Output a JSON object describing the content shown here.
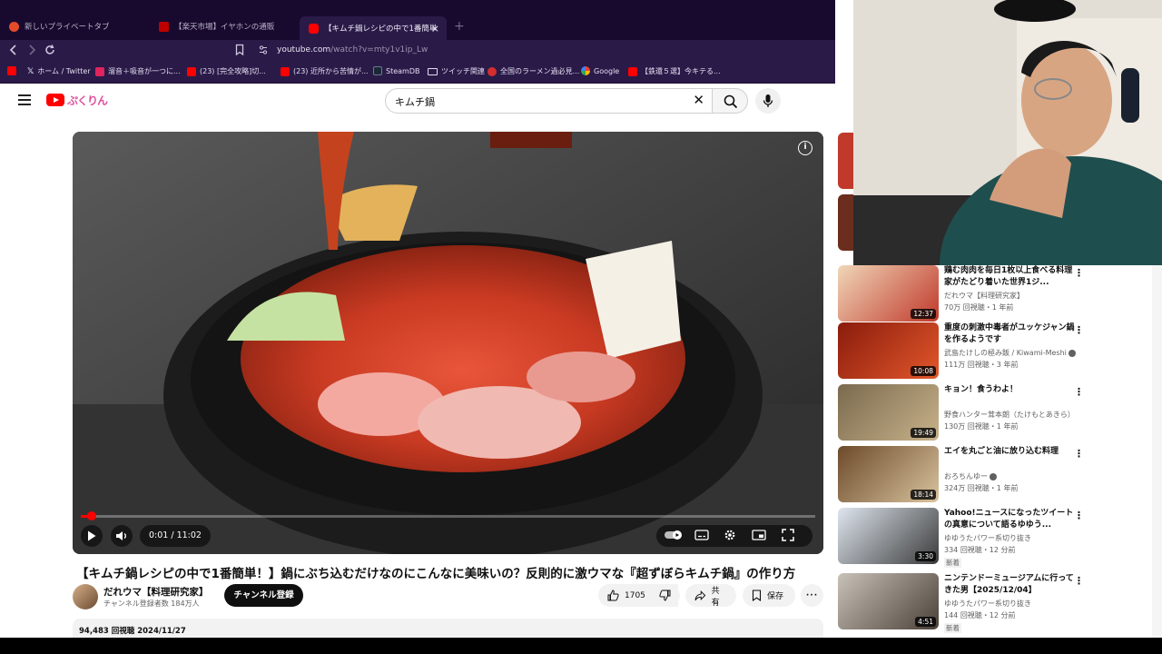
{
  "browser": {
    "tabs": [
      {
        "label": "新しいプライベートタブ",
        "color": "#e34b2a",
        "active": false
      },
      {
        "label": "【楽天市場】イヤホンの通販",
        "color": "#bf0000",
        "active": false
      },
      {
        "label": "【キムチ鍋レシピの中で1番簡単！】鍋",
        "color": "#ff0000",
        "active": true
      }
    ],
    "close_glyph": "×",
    "new_tab_glyph": "+",
    "url_host": "youtube.com",
    "url_path": "/watch?v=mty1v1ip_Lw",
    "bookmarks": [
      {
        "label": "",
        "color": "#ff0000"
      },
      {
        "label": "ホーム / Twitter",
        "color": "#000000"
      },
      {
        "label": "溜音＋吸音が一つに...",
        "color": "#e0245e"
      },
      {
        "label": "(23) [完全攻略]切...",
        "color": "#ff0000"
      },
      {
        "label": "(23) 近所から苦情が...",
        "color": "#ff0000"
      },
      {
        "label": "SteamDB",
        "color": "#1b2838"
      },
      {
        "label": "ツイッチ関連",
        "color": "#f5f5f5"
      },
      {
        "label": "全国のラーメン過必見...",
        "color": "#d32f2f"
      },
      {
        "label": "Google",
        "color": "#4285f4"
      },
      {
        "label": "【鉄還５選】今キテる...",
        "color": "#ff0000"
      }
    ]
  },
  "youtube": {
    "search_query": "キムチ鍋",
    "doodle": "ぷくりん",
    "player": {
      "current_time": "0:01",
      "duration": "11:02",
      "progress": 0.015
    },
    "video_title": "【キムチ鍋レシピの中で1番簡単！】鍋にぶち込むだけなのにこんなに美味いの？反則的に激ウマな『超ずぼらキムチ鍋』の作り方",
    "channel": {
      "name": "だれウマ【料理研究家】",
      "subs": "チャンネル登録者数 184万人"
    },
    "subscribe_label": "チャンネル登録",
    "likes": "1705",
    "share_label": "共有",
    "save_label": "保存",
    "desc_meta": "94,483 回視聴  2024/11/27",
    "recommendations": [
      {
        "title": "鶏む肉肉を毎日1枚以上食べる料理家がたどり着いた世界1ジ...",
        "channel": "だれウマ【料理研究家】",
        "meta": "70万 回視聴・1 年前",
        "duration": "12:37",
        "new": false,
        "verified": false,
        "thumb": [
          "#f0d6b8",
          "#c0392b"
        ]
      },
      {
        "title": "重度の刺激中毒者がユッケジャン鍋を作るようです",
        "channel": "武島たけしの極み飯 / Kiwami-Meshi",
        "meta": "111万 回視聴・3 年前",
        "duration": "10:08",
        "new": false,
        "verified": true,
        "thumb": [
          "#8a1c0c",
          "#e2572b"
        ]
      },
      {
        "title": "キョン！食うわよ！",
        "channel": "野食ハンター茸本朗（たけもとあきら）",
        "meta": "130万 回視聴・1 年前",
        "duration": "19:49",
        "new": false,
        "verified": false,
        "thumb": [
          "#7a6a4e",
          "#c8b28a"
        ]
      },
      {
        "title": "エイを丸ごと油に放り込む料理",
        "channel": "おろちんゆー",
        "meta": "324万 回視聴・1 年前",
        "duration": "18:14",
        "new": false,
        "verified": true,
        "thumb": [
          "#6c4a2a",
          "#d9c39e"
        ]
      },
      {
        "title": "Yahoo!ニュースになったツイートの真意について語るゆゆう...",
        "channel": "ゆゆうたパワー系切り抜き",
        "meta": "334 回視聴・12 分前",
        "duration": "3:30",
        "new": true,
        "verified": false,
        "thumb": [
          "#dfe6ef",
          "#3a3a3a"
        ]
      },
      {
        "title": "ニンテンドーミュージアムに行ってきた男【2025/12/04】",
        "channel": "ゆゆうたパワー系切り抜き",
        "meta": "144 回視聴・12 分前",
        "duration": "4:51",
        "new": true,
        "verified": false,
        "thumb": [
          "#c9c2b8",
          "#4a4038"
        ]
      }
    ],
    "new_badge": "新着",
    "more_glyph": "⋮"
  },
  "colors": {
    "chrome_dark": "#180a2e",
    "chrome": "#2a1a48",
    "yt_red": "#ff0000"
  }
}
